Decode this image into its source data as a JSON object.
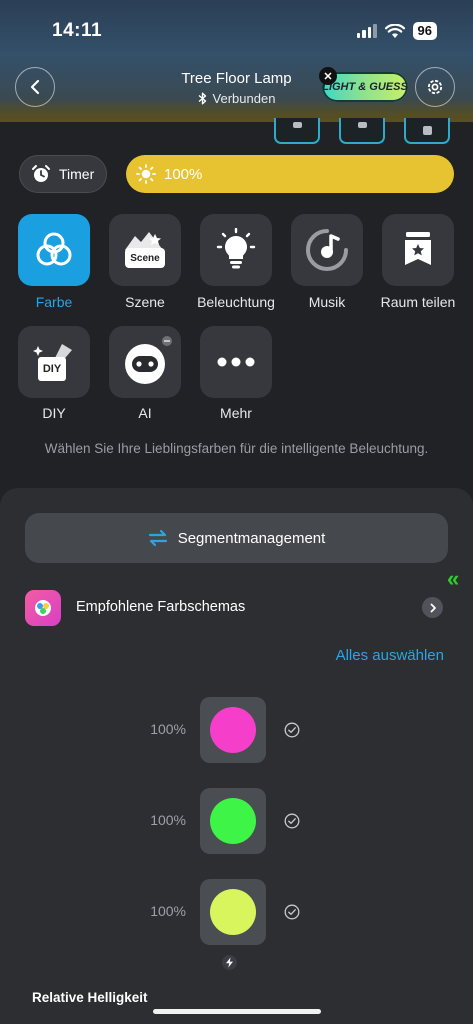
{
  "status_bar": {
    "time": "14:11",
    "battery": "96"
  },
  "header": {
    "title": "Tree Floor Lamp",
    "connection": "Verbunden",
    "game_badge": "LIGHT & GUESS"
  },
  "controls": {
    "timer_label": "Timer",
    "brightness": "100%"
  },
  "features": [
    {
      "label": "Farbe",
      "icon": "color-circles-icon",
      "active": true
    },
    {
      "label": "Szene",
      "icon": "scene-icon",
      "icon_text": "Scene"
    },
    {
      "label": "Beleuchtung",
      "icon": "lightbulb-icon"
    },
    {
      "label": "Musik",
      "icon": "music-icon"
    },
    {
      "label": "Raum teilen",
      "icon": "share-room-icon"
    },
    {
      "label": "DIY",
      "icon": "diy-icon",
      "icon_text": "DIY"
    },
    {
      "label": "AI",
      "icon": "ai-robot-icon"
    },
    {
      "label": "Mehr",
      "icon": "more-icon"
    }
  ],
  "description": "Wählen Sie Ihre Lieblingsfarben für die intelligente Beleuchtung.",
  "panel": {
    "segment_button": "Segmentmanagement",
    "recommended_label": "Empfohlene Farbschemas",
    "select_all": "Alles auswählen",
    "colors": [
      {
        "percent": "100%",
        "color": "#f53fcb"
      },
      {
        "percent": "100%",
        "color": "#3df447"
      },
      {
        "percent": "100%",
        "color": "#d8f55d"
      }
    ],
    "relative_brightness": "Relative Helligkeit"
  },
  "accent_colors": {
    "blue": "#1aa0e0",
    "yellow": "#e8c331",
    "panel": "#2c2e32"
  }
}
